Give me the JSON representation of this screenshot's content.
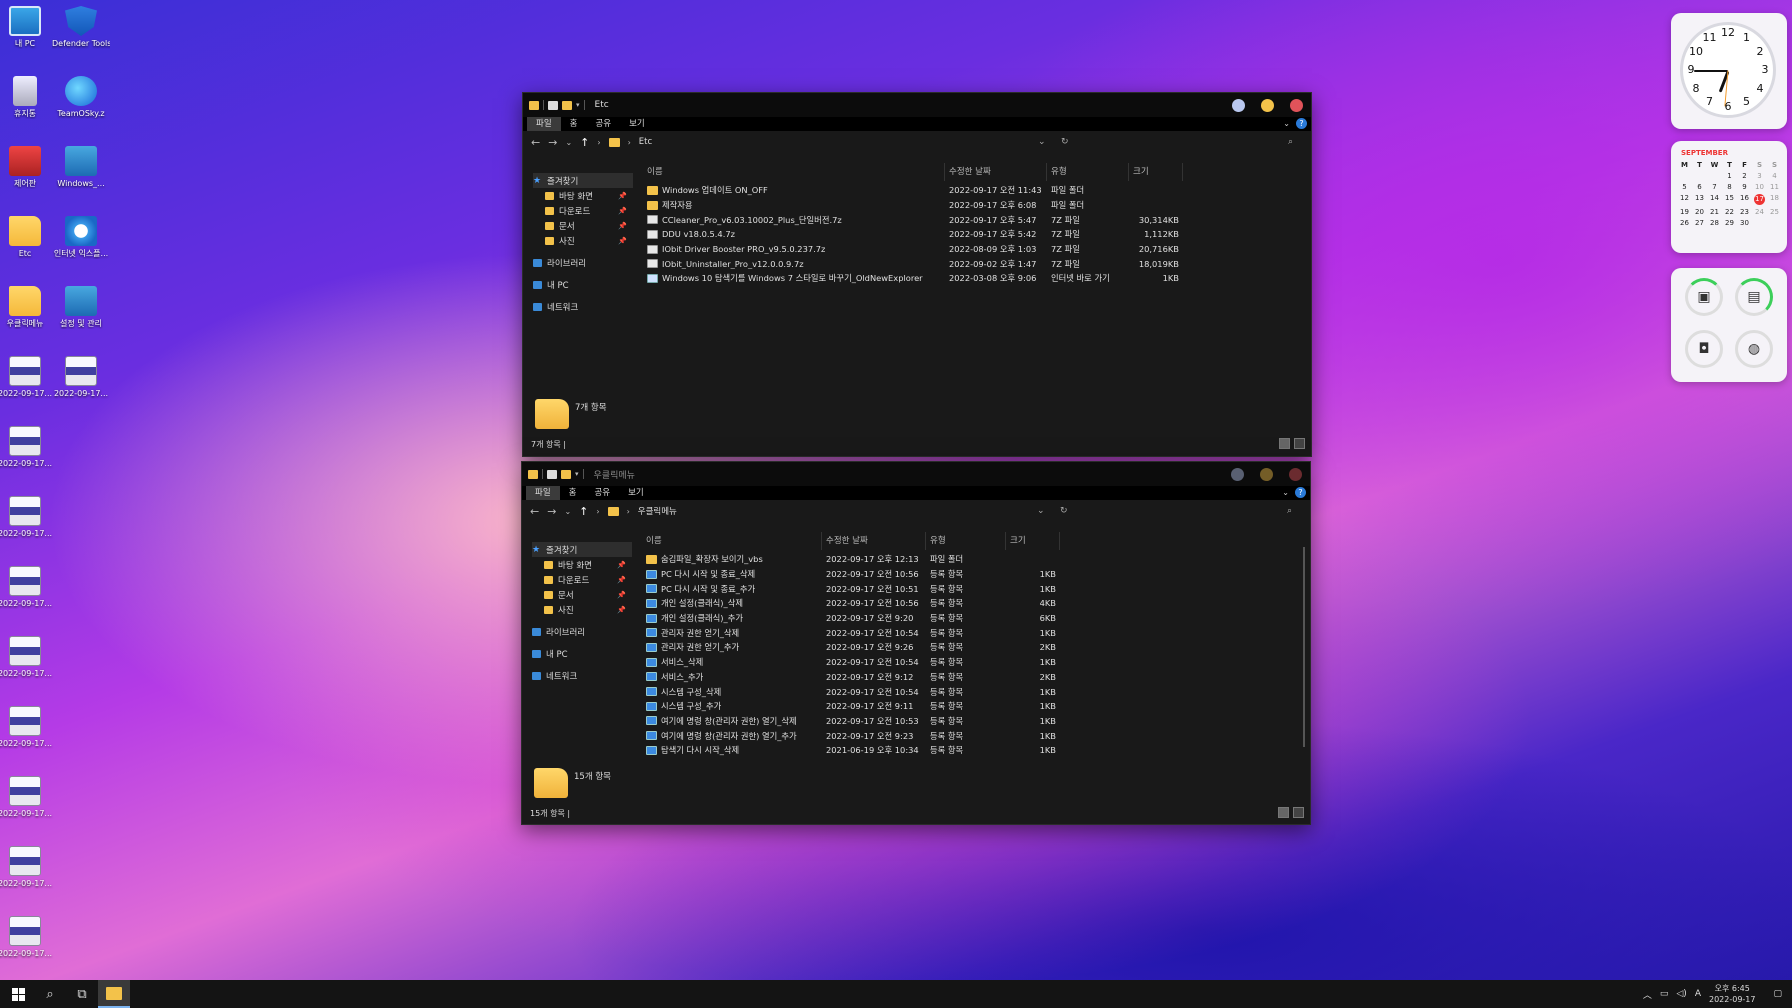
{
  "desktop": {
    "icons": [
      {
        "label": "내 PC",
        "kind": "ic-monitor"
      },
      {
        "label": "Defender Tools.exe",
        "kind": "ic-shield"
      },
      {
        "label": "휴지통",
        "kind": "ic-recycle"
      },
      {
        "label": "TeamOSky.z",
        "kind": "ic-globe"
      },
      {
        "label": "제어판",
        "kind": "ic-tool"
      },
      {
        "label": "Windows_...",
        "kind": "ic-gear"
      },
      {
        "label": "Etc",
        "kind": "ic-folder"
      },
      {
        "label": "인터넷 익스플...",
        "kind": "ic-ie"
      },
      {
        "label": "우클릭메뉴",
        "kind": "ic-folder"
      },
      {
        "label": "설정 및 관리",
        "kind": "ic-gear"
      },
      {
        "label": "2022-09-17...",
        "kind": "ic-shot"
      },
      {
        "label": "2022-09-17...",
        "kind": "ic-shot"
      },
      {
        "label": "2022-09-17...",
        "kind": "ic-shot"
      },
      {
        "label": "2022-09-17...",
        "kind": "ic-shot"
      },
      {
        "label": "2022-09-17...",
        "kind": "ic-shot"
      },
      {
        "label": "2022-09-17...",
        "kind": "ic-shot"
      },
      {
        "label": "2022-09-17...",
        "kind": "ic-shot"
      },
      {
        "label": "2022-09-17...",
        "kind": "ic-shot"
      },
      {
        "label": "2022-09-17...",
        "kind": "ic-shot"
      },
      {
        "label": "2022-09-17...",
        "kind": "ic-shot"
      }
    ]
  },
  "window1": {
    "title": "Etc",
    "tabs": {
      "file": "파일",
      "home": "홈",
      "share": "공유",
      "view": "보기"
    },
    "path": "Etc",
    "nav_pane": {
      "quick_access": "즐겨찾기",
      "desktop": "바탕 화면",
      "downloads": "다운로드",
      "documents": "문서",
      "pictures": "사진",
      "libraries": "라이브러리",
      "this_pc": "내 PC",
      "network": "네트워크"
    },
    "headers": {
      "name": "이름",
      "date": "수정한 날짜",
      "type": "유형",
      "size": "크기"
    },
    "rows": [
      {
        "name": "Windows 업데이트 ON_OFF",
        "date": "2022-09-17 오전 11:43",
        "type": "파일 폴더",
        "size": "",
        "icon": "folder"
      },
      {
        "name": "제작자용",
        "date": "2022-09-17 오후 6:08",
        "type": "파일 폴더",
        "size": "",
        "icon": "folder"
      },
      {
        "name": "CCleaner_Pro_v6.03.10002_Plus_단일버전.7z",
        "date": "2022-09-17 오후 5:47",
        "type": "7Z 파일",
        "size": "30,314KB",
        "icon": "archive"
      },
      {
        "name": "DDU v18.0.5.4.7z",
        "date": "2022-09-17 오후 5:42",
        "type": "7Z 파일",
        "size": "1,112KB",
        "icon": "archive"
      },
      {
        "name": "IObit Driver Booster PRO_v9.5.0.237.7z",
        "date": "2022-08-09 오후 1:03",
        "type": "7Z 파일",
        "size": "20,716KB",
        "icon": "archive"
      },
      {
        "name": "IObit_Uninstaller_Pro_v12.0.0.9.7z",
        "date": "2022-09-02 오후 1:47",
        "type": "7Z 파일",
        "size": "18,019KB",
        "icon": "archive"
      },
      {
        "name": "Windows 10 탐색기를 Windows 7 스타일로 바꾸기_OldNewExplorer",
        "date": "2022-03-08 오후 9:06",
        "type": "인터넷 바로 가기",
        "size": "1KB",
        "icon": "link"
      }
    ],
    "detail_count": "7개 항목",
    "status": "7개 항목 |"
  },
  "window2": {
    "title": "우클릭메뉴",
    "tabs": {
      "file": "파일",
      "home": "홈",
      "share": "공유",
      "view": "보기"
    },
    "path": "우클릭메뉴",
    "nav_pane": {
      "quick_access": "즐겨찾기",
      "desktop": "바탕 화면",
      "downloads": "다운로드",
      "documents": "문서",
      "pictures": "사진",
      "libraries": "라이브러리",
      "this_pc": "내 PC",
      "network": "네트워크"
    },
    "headers": {
      "name": "이름",
      "date": "수정한 날짜",
      "type": "유형",
      "size": "크기"
    },
    "rows": [
      {
        "name": "숨김파일_확장자 보이기_vbs",
        "date": "2022-09-17 오후 12:13",
        "type": "파일 폴더",
        "size": "",
        "icon": "folder"
      },
      {
        "name": "PC 다시 시작 및 종료_삭제",
        "date": "2022-09-17 오전 10:56",
        "type": "등록 항목",
        "size": "1KB",
        "icon": "reg"
      },
      {
        "name": "PC 다시 시작 및 종료_추가",
        "date": "2022-09-17 오전 10:51",
        "type": "등록 항목",
        "size": "1KB",
        "icon": "reg"
      },
      {
        "name": "개인 설정(클래식)_삭제",
        "date": "2022-09-17 오전 10:56",
        "type": "등록 항목",
        "size": "4KB",
        "icon": "reg"
      },
      {
        "name": "개인 설정(클래식)_추가",
        "date": "2022-09-17 오전 9:20",
        "type": "등록 항목",
        "size": "6KB",
        "icon": "reg"
      },
      {
        "name": "관리자 권한 얻기_삭제",
        "date": "2022-09-17 오전 10:54",
        "type": "등록 항목",
        "size": "1KB",
        "icon": "reg"
      },
      {
        "name": "관리자 권한 얻기_추가",
        "date": "2022-09-17 오전 9:26",
        "type": "등록 항목",
        "size": "2KB",
        "icon": "reg"
      },
      {
        "name": "서비스_삭제",
        "date": "2022-09-17 오전 10:54",
        "type": "등록 항목",
        "size": "1KB",
        "icon": "reg"
      },
      {
        "name": "서비스_추가",
        "date": "2022-09-17 오전 9:12",
        "type": "등록 항목",
        "size": "2KB",
        "icon": "reg"
      },
      {
        "name": "시스템 구성_삭제",
        "date": "2022-09-17 오전 10:54",
        "type": "등록 항목",
        "size": "1KB",
        "icon": "reg"
      },
      {
        "name": "시스템 구성_추가",
        "date": "2022-09-17 오전 9:11",
        "type": "등록 항목",
        "size": "1KB",
        "icon": "reg"
      },
      {
        "name": "여기에 명령 창(관리자 권한) 열기_삭제",
        "date": "2022-09-17 오전 10:53",
        "type": "등록 항목",
        "size": "1KB",
        "icon": "reg"
      },
      {
        "name": "여기에 명령 창(관리자 권한) 열기_추가",
        "date": "2022-09-17 오전 9:23",
        "type": "등록 항목",
        "size": "1KB",
        "icon": "reg"
      },
      {
        "name": "탐색기 다시 시작_삭제",
        "date": "2021-06-19 오후 10:34",
        "type": "등록 항목",
        "size": "1KB",
        "icon": "reg"
      }
    ],
    "detail_count": "15개 항목",
    "status": "15개 항목 |"
  },
  "widgets": {
    "clock_numbers": [
      "12",
      "1",
      "2",
      "3",
      "4",
      "5",
      "6",
      "7",
      "8",
      "9",
      "10",
      "11"
    ],
    "calendar": {
      "month": "SEPTEMBER",
      "day_names": [
        "M",
        "T",
        "W",
        "T",
        "F",
        "S",
        "S"
      ],
      "weeks": [
        [
          "",
          "",
          "",
          "1",
          "2",
          "3",
          "4"
        ],
        [
          "5",
          "6",
          "7",
          "8",
          "9",
          "10",
          "11"
        ],
        [
          "12",
          "13",
          "14",
          "15",
          "16",
          "17",
          "18"
        ],
        [
          "19",
          "20",
          "21",
          "22",
          "23",
          "24",
          "25"
        ],
        [
          "26",
          "27",
          "28",
          "29",
          "30",
          "",
          ""
        ]
      ],
      "today": "17"
    }
  },
  "taskbar": {
    "time": "오후 6:45",
    "date": "2022-09-17",
    "ime": "A"
  },
  "colors": {
    "close": "#e0535a",
    "minimize": "#f3c24a",
    "maximize": "#b9c8ef",
    "accent": "#2a7ad8"
  }
}
